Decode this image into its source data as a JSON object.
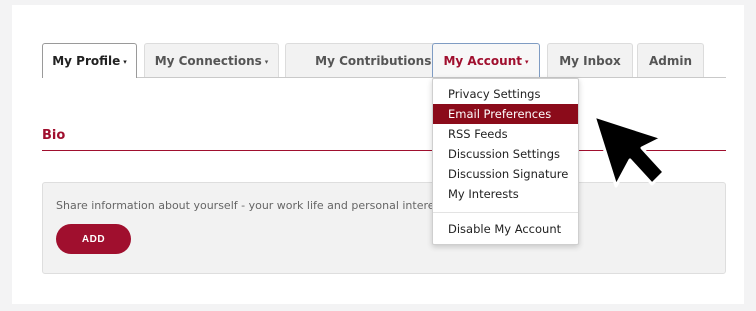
{
  "tabs": [
    {
      "label": "My Profile",
      "caret": "▾"
    },
    {
      "label": "My Connections",
      "caret": "▾"
    },
    {
      "label": "My Contributions",
      "caret": "▾"
    },
    {
      "label": "My Account",
      "caret": "▾"
    },
    {
      "label": "My Inbox"
    },
    {
      "label": "Admin"
    }
  ],
  "dropdown": {
    "items": [
      "Privacy Settings",
      "Email Preferences",
      "RSS Feeds",
      "Discussion Settings",
      "Discussion Signature",
      "My Interests"
    ],
    "selected": "Email Preferences",
    "footer_item": "Disable My Account"
  },
  "bio": {
    "title": "Bio",
    "prompt": "Share information about yourself - your work life and personal intere",
    "add_label": "ADD"
  },
  "colors": {
    "accent": "#a00f2e",
    "selected_bg": "#8b0b1a",
    "page_bg": "#f3f3f4"
  },
  "icons": {
    "tab_caret": "caret-down-icon",
    "cursor": "mouse-pointer-icon"
  }
}
